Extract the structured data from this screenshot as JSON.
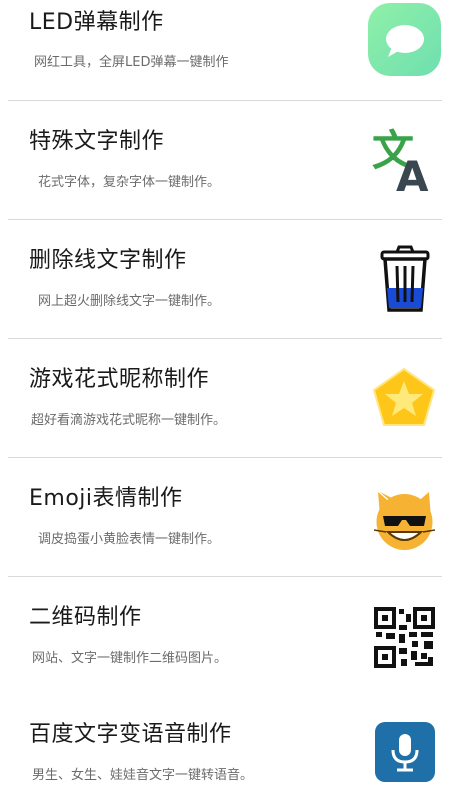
{
  "items": [
    {
      "title": "LED弹幕制作",
      "desc": "网红工具，全屏LED弹幕一键制作",
      "icon": "chat-bubble-icon"
    },
    {
      "title": "特殊文字制作",
      "desc": "花式字体，复杂字体一键制作。",
      "icon": "translate-icon"
    },
    {
      "title": "删除线文字制作",
      "desc": "网上超火删除线文字一键制作。",
      "icon": "trash-can-icon"
    },
    {
      "title": "游戏花式昵称制作",
      "desc": "超好看滴游戏花式昵称一键制作。",
      "icon": "star-badge-icon"
    },
    {
      "title": "Emoji表情制作",
      "desc": "调皮捣蛋小黄脸表情一键制作。",
      "icon": "cool-cat-emoji-icon"
    },
    {
      "title": "二维码制作",
      "desc": "网站、文字一键制作二维码图片。",
      "icon": "qr-code-icon"
    },
    {
      "title": "百度文字变语音制作",
      "desc": "男生、女生、娃娃音文字一键转语音。",
      "icon": "microphone-icon"
    }
  ],
  "colors": {
    "led_green": "#7fe6a6",
    "translate_green": "#3aa34a",
    "bin_blue": "#1a4bd6",
    "star_yellow": "#ffc61a",
    "mic_blue": "#1f6fa8"
  }
}
